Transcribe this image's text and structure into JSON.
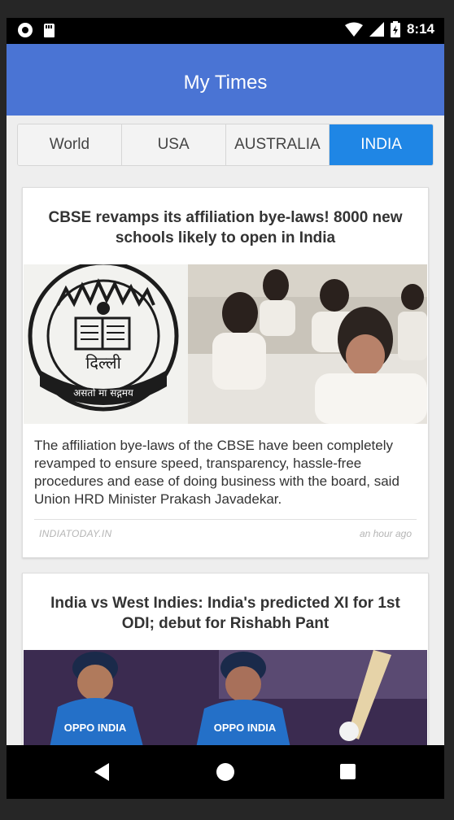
{
  "status_bar": {
    "time": "8:14"
  },
  "app_bar": {
    "title": "My Times"
  },
  "tabs": [
    {
      "label": "World"
    },
    {
      "label": "USA"
    },
    {
      "label": "AUSTRALIA"
    },
    {
      "label": "INDIA",
      "active": true
    }
  ],
  "articles": [
    {
      "title": "CBSE revamps its affiliation bye-laws! 8000 new schools likely to open in India",
      "description": "The affiliation bye-laws of the CBSE have been completely revamped to ensure speed, transparency, hassle-free procedures and ease of doing business with the board, said Union HRD Minister Prakash Javadekar.",
      "source": "INDIATODAY.IN",
      "time": "an hour ago",
      "image_logo_text": "दिल्ली",
      "image_logo_motto": "असतो मा सद्गमय"
    },
    {
      "title": "India vs West Indies: India's predicted XI for 1st ODI; debut for Rishabh Pant",
      "jersey_text": "OPPO INDIA"
    }
  ],
  "colors": {
    "app_bar": "#4a74d4",
    "active_tab": "#1f86e5"
  }
}
